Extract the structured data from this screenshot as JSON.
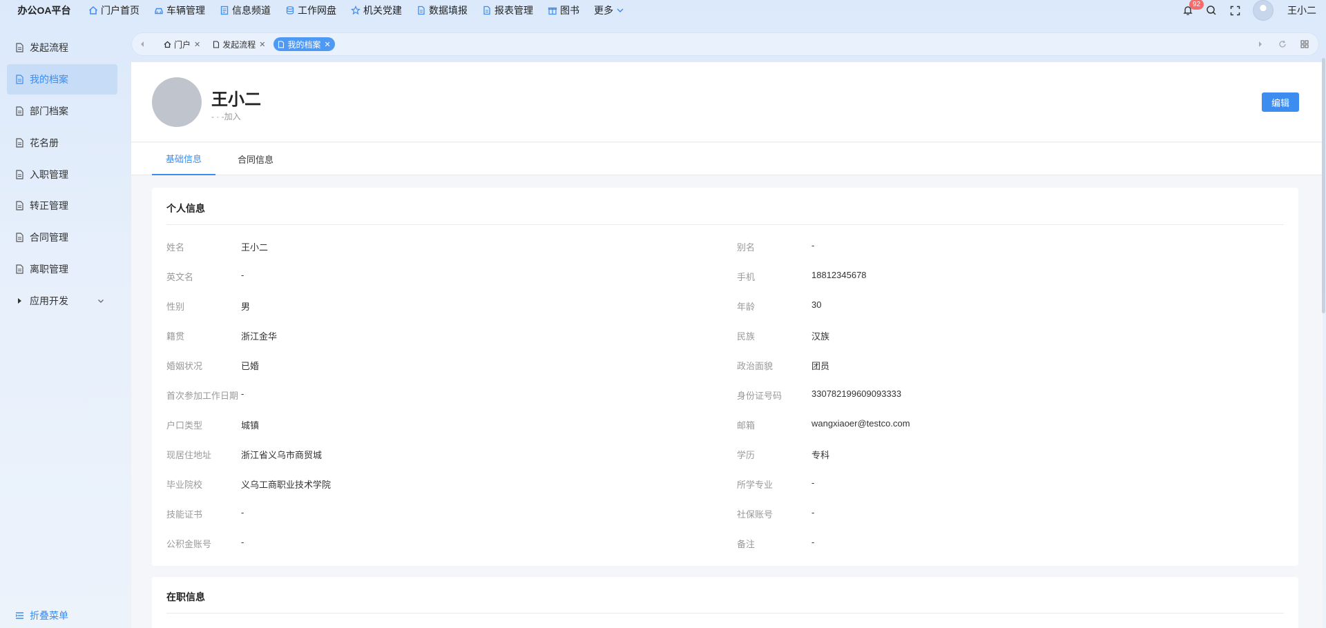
{
  "app": {
    "title": "办公OA平台"
  },
  "topnav": [
    {
      "label": "门户首页",
      "icon": "home-icon"
    },
    {
      "label": "车辆管理",
      "icon": "car-icon"
    },
    {
      "label": "信息频道",
      "icon": "document-icon"
    },
    {
      "label": "工作网盘",
      "icon": "database-icon"
    },
    {
      "label": "机关党建",
      "icon": "star-icon"
    },
    {
      "label": "数据填报",
      "icon": "file-icon"
    },
    {
      "label": "报表管理",
      "icon": "file-icon"
    },
    {
      "label": "图书",
      "icon": "gift-icon"
    },
    {
      "label": "更多",
      "icon": "chevron-down-icon"
    }
  ],
  "header": {
    "notification_count": "92",
    "username": "王小二"
  },
  "sidebar": {
    "items": [
      {
        "label": "发起流程"
      },
      {
        "label": "我的档案",
        "active": true
      },
      {
        "label": "部门档案"
      },
      {
        "label": "花名册"
      },
      {
        "label": "入职管理"
      },
      {
        "label": "转正管理"
      },
      {
        "label": "合同管理"
      },
      {
        "label": "离职管理"
      },
      {
        "label": "应用开发"
      }
    ],
    "collapse_label": "折叠菜单"
  },
  "page_tabs": [
    {
      "label": "门户"
    },
    {
      "label": "发起流程"
    },
    {
      "label": "我的档案",
      "active": true
    }
  ],
  "profile": {
    "name": "王小二",
    "join_text": "- · -加入",
    "edit_label": "编辑"
  },
  "content_tabs": [
    {
      "label": "基础信息",
      "active": true
    },
    {
      "label": "合同信息"
    }
  ],
  "personal_info": {
    "title": "个人信息",
    "fields": [
      {
        "label": "姓名",
        "value": "王小二"
      },
      {
        "label": "别名",
        "value": "-"
      },
      {
        "label": "英文名",
        "value": "-"
      },
      {
        "label": "手机",
        "value": "18812345678"
      },
      {
        "label": "性别",
        "value": "男"
      },
      {
        "label": "年龄",
        "value": "30"
      },
      {
        "label": "籍贯",
        "value": "浙江金华"
      },
      {
        "label": "民族",
        "value": "汉族"
      },
      {
        "label": "婚姻状况",
        "value": "已婚"
      },
      {
        "label": "政治面貌",
        "value": "团员"
      },
      {
        "label": "首次参加工作日期",
        "value": "-"
      },
      {
        "label": "身份证号码",
        "value": "330782199609093333"
      },
      {
        "label": "户口类型",
        "value": "城镇"
      },
      {
        "label": "邮箱",
        "value": "wangxiaoer@testco.com"
      },
      {
        "label": "现居住地址",
        "value": "浙江省义乌市商贸城"
      },
      {
        "label": "学历",
        "value": "专科"
      },
      {
        "label": "毕业院校",
        "value": "义乌工商职业技术学院"
      },
      {
        "label": "所学专业",
        "value": "-"
      },
      {
        "label": "技能证书",
        "value": "-"
      },
      {
        "label": "社保账号",
        "value": "-"
      },
      {
        "label": "公积金账号",
        "value": "-"
      },
      {
        "label": "备注",
        "value": "-"
      }
    ]
  },
  "job_info": {
    "title": "在职信息"
  },
  "colors": {
    "accent": "#3d8cf0",
    "badge": "#f56c6c",
    "avatar": "#c0c4cc"
  }
}
